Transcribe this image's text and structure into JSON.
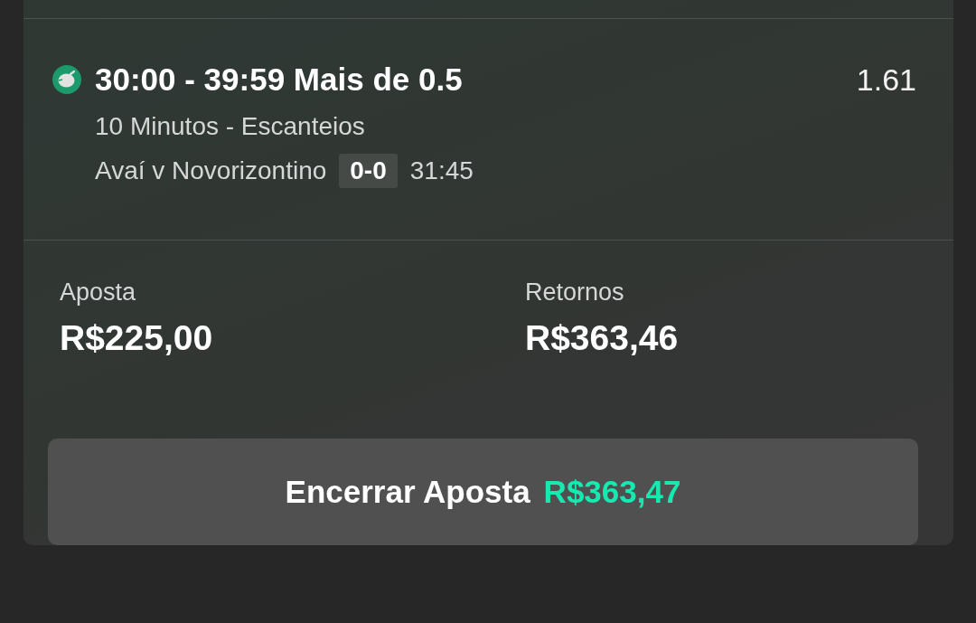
{
  "selection": {
    "title": "30:00 - 39:59 Mais de 0.5",
    "odds": "1.61",
    "market": "10 Minutos - Escanteios",
    "match": "Avaí v Novorizontino",
    "score": "0-0",
    "clock": "31:45"
  },
  "summary": [
    {
      "label": "Aposta",
      "value": "R$225,00"
    },
    {
      "label": "Retornos",
      "value": "R$363,46"
    }
  ],
  "cash_out_button": {
    "label": "Encerrar Aposta",
    "amount": "R$363,47"
  }
}
